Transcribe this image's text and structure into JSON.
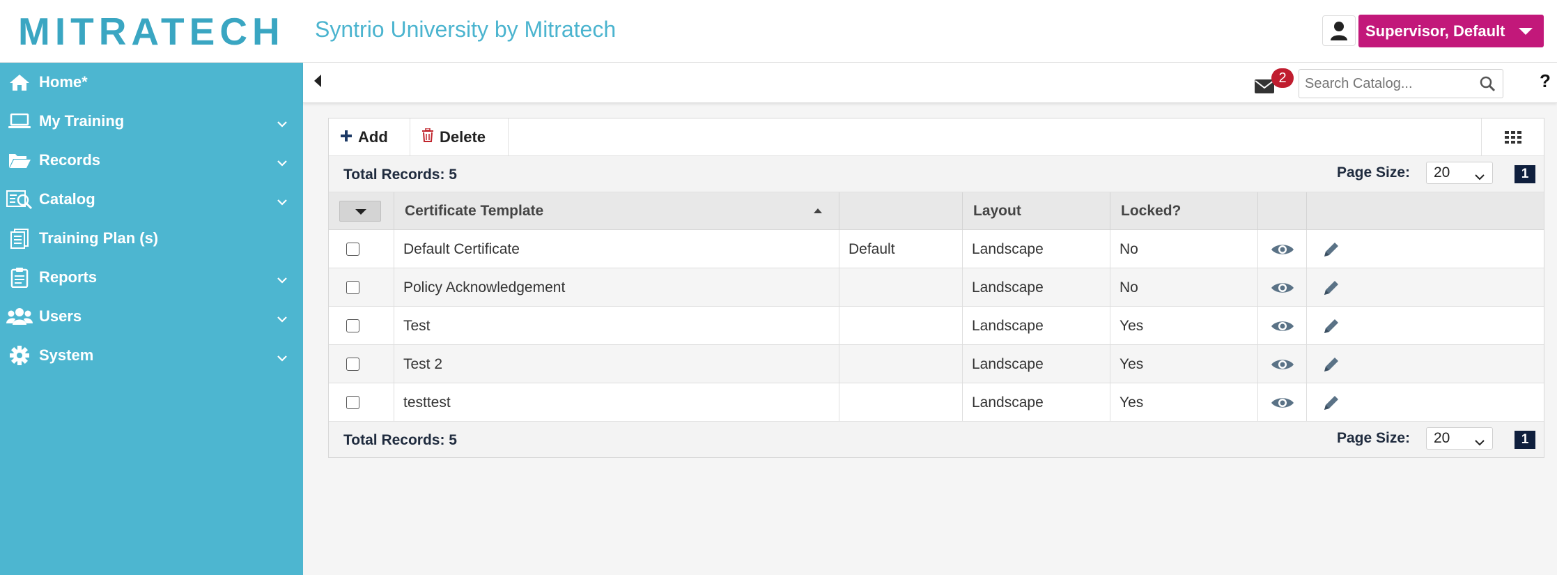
{
  "header": {
    "logo": "MITRATECH",
    "app_title": "Syntrio University by Mitratech",
    "user_name": "Supervisor, Default"
  },
  "sidebar": {
    "items": [
      {
        "label": "Home*",
        "icon": "home-icon",
        "has_submenu": false
      },
      {
        "label": "My Training",
        "icon": "laptop-icon",
        "has_submenu": true
      },
      {
        "label": "Records",
        "icon": "folder-open-icon",
        "has_submenu": true
      },
      {
        "label": "Catalog",
        "icon": "catalog-search-icon",
        "has_submenu": true
      },
      {
        "label": "Training Plan (s)",
        "icon": "documents-icon",
        "has_submenu": false
      },
      {
        "label": "Reports",
        "icon": "clipboard-icon",
        "has_submenu": true
      },
      {
        "label": "Users",
        "icon": "users-icon",
        "has_submenu": true
      },
      {
        "label": "System",
        "icon": "gear-icon",
        "has_submenu": true
      }
    ]
  },
  "topbar": {
    "message_count": "2",
    "search_placeholder": "Search Catalog...",
    "help": "?"
  },
  "toolbar": {
    "add_label": "Add",
    "delete_label": "Delete"
  },
  "pager": {
    "total_label": "Total Records: 5",
    "page_size_label": "Page Size:",
    "page_size_value": "20",
    "current_page": "1"
  },
  "table": {
    "columns": [
      "",
      "Certificate Template",
      "",
      "Layout",
      "Locked?",
      "",
      ""
    ],
    "sorted_column": "Certificate Template",
    "sort_direction": "ascending",
    "rows": [
      {
        "name": "Default Certificate",
        "default": "Default",
        "layout": "Landscape",
        "locked": "No"
      },
      {
        "name": "Policy Acknowledgement",
        "default": "",
        "layout": "Landscape",
        "locked": "No"
      },
      {
        "name": "Test",
        "default": "",
        "layout": "Landscape",
        "locked": "Yes"
      },
      {
        "name": "Test 2",
        "default": "",
        "layout": "Landscape",
        "locked": "Yes"
      },
      {
        "name": "testtest",
        "default": "",
        "layout": "Landscape",
        "locked": "Yes"
      }
    ]
  },
  "colors": {
    "sidebar_bg": "#4db6d0",
    "brand": "#3aa6c2",
    "user_button": "#c2187a",
    "badge": "#c01d2f",
    "page_indicator": "#0f1f3d"
  }
}
